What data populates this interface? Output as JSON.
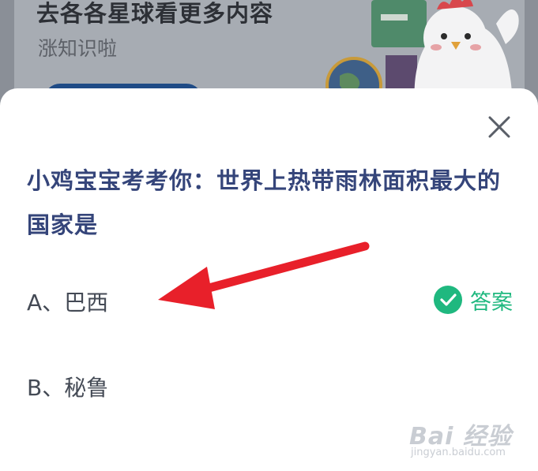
{
  "background_card": {
    "title": "去各各星球看更多内容",
    "subtitle": "涨知识啦"
  },
  "quiz": {
    "question": "小鸡宝宝考考你：世界上热带雨林面积最大的国家是",
    "options": [
      {
        "label": "A、巴西",
        "is_answer": true
      },
      {
        "label": "B、秘鲁",
        "is_answer": false
      }
    ],
    "answer_label": "答案"
  },
  "watermark": {
    "brand": "Bai 经验",
    "url": "jingyan.baidu.com"
  },
  "colors": {
    "question_text": "#35457a",
    "answer_green": "#1fb87f",
    "arrow_red": "#e8202a"
  }
}
